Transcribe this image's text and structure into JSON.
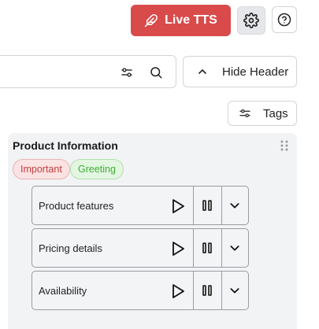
{
  "toolbar": {
    "live_tts_label": "Live TTS",
    "gear_icon": "gear-icon",
    "help_icon": "help-icon"
  },
  "search": {
    "value": "",
    "placeholder": ""
  },
  "controls": {
    "hide_header_label": "Hide Header",
    "tags_label": "Tags"
  },
  "card": {
    "title": "Product Information",
    "tags": [
      {
        "label": "Important",
        "color": "#c43d3d"
      },
      {
        "label": "Greeting",
        "color": "#3fae36"
      }
    ],
    "items": [
      {
        "label": "Product features"
      },
      {
        "label": "Pricing details"
      },
      {
        "label": "Availability"
      }
    ]
  },
  "colors": {
    "accent": "#d94a4a",
    "card_bg": "#f2f3f5"
  }
}
